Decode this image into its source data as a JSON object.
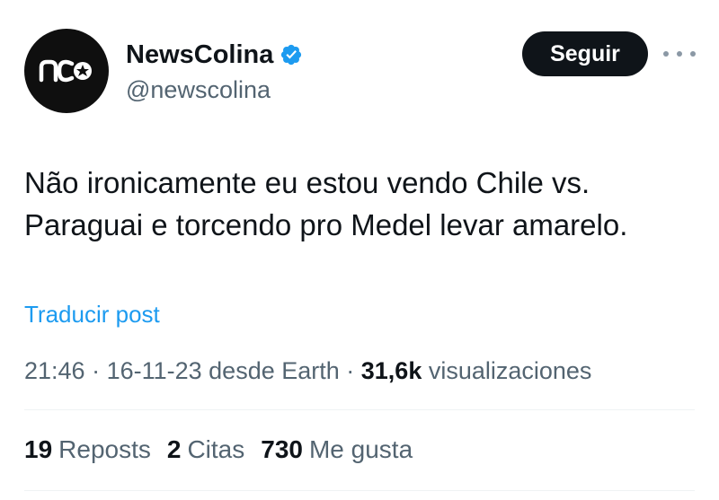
{
  "author": {
    "name": "NewsColina",
    "handle": "@newscolina",
    "avatar_text": "nc",
    "verified": true,
    "verified_color": "#1d9bf0"
  },
  "actions": {
    "follow_label": "Seguir",
    "more_icon": "more-dots-icon"
  },
  "post": {
    "text": "Não ironicamente eu estou vendo Chile vs. Paraguai e torcendo pro Medel levar amarelo.",
    "translate_label": "Traducir post"
  },
  "meta": {
    "time": "21:46",
    "sep1": " · ",
    "date": "16-11-23",
    "source": " desde Earth",
    "sep2": " · ",
    "views_count": "31,6k",
    "views_label": " visualizaciones"
  },
  "stats": {
    "reposts_count": "19",
    "reposts_label": "Reposts",
    "quotes_count": "2",
    "quotes_label": "Citas",
    "likes_count": "730",
    "likes_label": "Me gusta"
  },
  "colors": {
    "accent": "#1d9bf0",
    "text": "#0f1419",
    "secondary": "#536471"
  }
}
